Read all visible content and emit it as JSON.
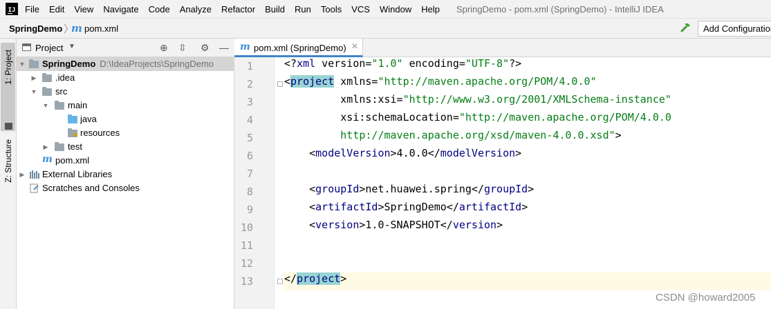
{
  "menu": {
    "logo_text": "IJ",
    "items": [
      "File",
      "Edit",
      "View",
      "Navigate",
      "Code",
      "Analyze",
      "Refactor",
      "Build",
      "Run",
      "Tools",
      "VCS",
      "Window",
      "Help"
    ],
    "window_title": "SpringDemo - pom.xml (SpringDemo) - IntelliJ IDEA"
  },
  "navbar": {
    "project": "SpringDemo",
    "file_icon": "m",
    "file": "pom.xml",
    "build_icon": "hammer-icon",
    "add_configuration": "Add Configuration..."
  },
  "tool_stripe": {
    "project_label": "1: Project",
    "structure_label": "Z: Structure"
  },
  "project_panel": {
    "title": "Project",
    "tree": [
      {
        "label": "SpringDemo",
        "path": "D:\\IdeaProjects\\SpringDemo",
        "icon": "module-folder-icon",
        "expanded": true,
        "bold": true
      },
      {
        "label": ".idea",
        "icon": "folder-icon",
        "expanded": false
      },
      {
        "label": "src",
        "icon": "folder-icon",
        "expanded": true
      },
      {
        "label": "main",
        "icon": "folder-icon",
        "expanded": true
      },
      {
        "label": "java",
        "icon": "source-folder-icon"
      },
      {
        "label": "resources",
        "icon": "resources-folder-icon"
      },
      {
        "label": "test",
        "icon": "folder-icon",
        "expanded": false
      },
      {
        "label": "pom.xml",
        "icon": "maven-file-icon"
      },
      {
        "label": "External Libraries",
        "icon": "libraries-icon",
        "expanded": false
      },
      {
        "label": "Scratches and Consoles",
        "icon": "scratches-icon"
      }
    ]
  },
  "editor": {
    "tab_label": "pom.xml (SpringDemo)",
    "line_numbers": [
      "1",
      "2",
      "3",
      "4",
      "5",
      "6",
      "7",
      "8",
      "9",
      "10",
      "11",
      "12",
      "13"
    ],
    "current_line": 13,
    "code_lines": [
      "<?xml version=\"1.0\" encoding=\"UTF-8\"?>",
      "<project xmlns=\"http://maven.apache.org/POM/4.0.0\"",
      "         xmlns:xsi=\"http://www.w3.org/2001/XMLSchema-instance\"",
      "         xsi:schemaLocation=\"http://maven.apache.org/POM/4.0.0",
      "         http://maven.apache.org/xsd/maven-4.0.0.xsd\">",
      "    <modelVersion>4.0.0</modelVersion>",
      "",
      "    <groupId>net.huawei.spring</groupId>",
      "    <artifactId>SpringDemo</artifactId>",
      "    <version>1.0-SNAPSHOT</version>",
      "",
      "",
      "</project>"
    ]
  },
  "watermark": "CSDN @howard2005",
  "colors": {
    "tag": "#000080",
    "attr": "#0000ff",
    "ns_attr": "#871094",
    "value": "#067d17",
    "tag_highlight": "#99d4d4",
    "tab_underline": "#4083c9"
  }
}
